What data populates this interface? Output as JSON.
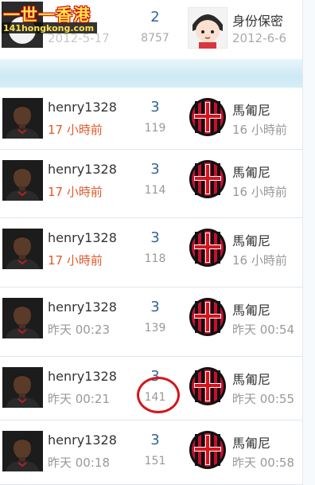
{
  "top_row": {
    "logo_text": "一世一香港",
    "logo_url_text": "141hongkong.com",
    "start_date": "2012-5-17",
    "replies": "2",
    "views": "8757",
    "last_poster": "身份保密",
    "last_date": "2012-6-6"
  },
  "threads": [
    {
      "author": "henry1328",
      "time": "17 小時前",
      "time_recent": true,
      "replies": "3",
      "views": "119",
      "last_poster": "馬匍尼",
      "last_time": "16 小時前"
    },
    {
      "author": "henry1328",
      "time": "17 小時前",
      "time_recent": true,
      "replies": "3",
      "views": "114",
      "last_poster": "馬匍尼",
      "last_time": "16 小時前"
    },
    {
      "author": "henry1328",
      "time": "17 小時前",
      "time_recent": true,
      "replies": "3",
      "views": "118",
      "last_poster": "馬匍尼",
      "last_time": "16 小時前"
    },
    {
      "author": "henry1328",
      "time": "昨天 00:23",
      "time_recent": false,
      "replies": "3",
      "views": "139",
      "last_poster": "馬匍尼",
      "last_time": "昨天 00:54"
    },
    {
      "author": "henry1328",
      "time": "昨天 00:21",
      "time_recent": false,
      "replies": "3",
      "views": "141",
      "last_poster": "馬匍尼",
      "last_time": "昨天 00:55"
    },
    {
      "author": "henry1328",
      "time": "昨天 00:18",
      "time_recent": false,
      "replies": "3",
      "views": "151",
      "last_poster": "馬匍尼",
      "last_time": "昨天 00:58"
    }
  ],
  "colors": {
    "recent_time": "#e05a2b",
    "reply_count": "#336699",
    "highlight_circle": "#d4161c"
  }
}
